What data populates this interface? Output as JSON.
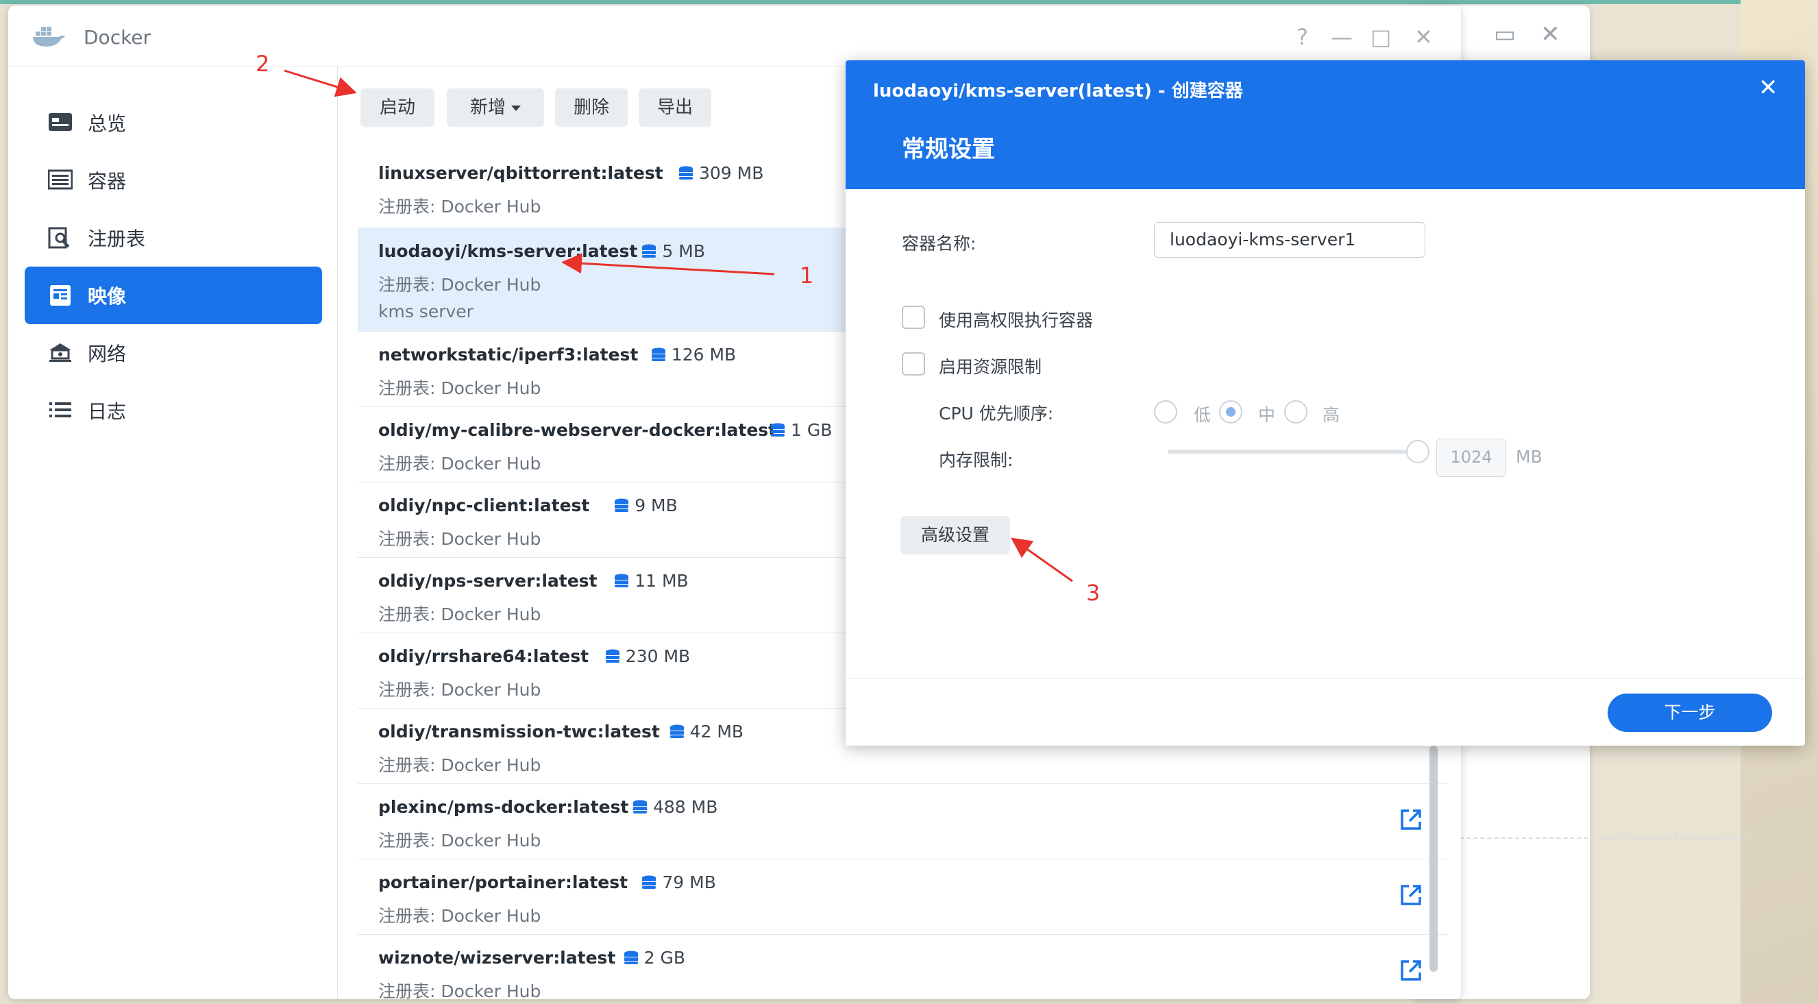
{
  "app": {
    "title": "Docker",
    "window_controls": [
      "?",
      "—",
      "□",
      "✕"
    ]
  },
  "sidebar": {
    "items": [
      {
        "label": "总览",
        "icon": "overview-icon",
        "active": false
      },
      {
        "label": "容器",
        "icon": "container-icon",
        "active": false
      },
      {
        "label": "注册表",
        "icon": "registry-icon",
        "active": false
      },
      {
        "label": "映像",
        "icon": "image-icon",
        "active": true
      },
      {
        "label": "网络",
        "icon": "network-icon",
        "active": false
      },
      {
        "label": "日志",
        "icon": "log-icon",
        "active": false
      }
    ]
  },
  "toolbar": {
    "launch": "启动",
    "add": "新增",
    "delete": "删除",
    "export": "导出"
  },
  "images": [
    {
      "name": "linuxserver/qbittorrent:latest",
      "size": "309 MB",
      "registry": "注册表: Docker Hub",
      "desc": ""
    },
    {
      "name": "luodaoyi/kms-server:latest",
      "size": "5 MB",
      "registry": "注册表: Docker Hub",
      "desc": "kms server"
    },
    {
      "name": "networkstatic/iperf3:latest",
      "size": "126 MB",
      "registry": "注册表: Docker Hub",
      "desc": ""
    },
    {
      "name": "oldiy/my-calibre-webserver-docker:latest",
      "size": "1 GB",
      "registry": "注册表: Docker Hub",
      "desc": ""
    },
    {
      "name": "oldiy/npc-client:latest",
      "size": "9 MB",
      "registry": "注册表: Docker Hub",
      "desc": ""
    },
    {
      "name": "oldiy/nps-server:latest",
      "size": "11 MB",
      "registry": "注册表: Docker Hub",
      "desc": ""
    },
    {
      "name": "oldiy/rrshare64:latest",
      "size": "230 MB",
      "registry": "注册表: Docker Hub",
      "desc": ""
    },
    {
      "name": "oldiy/transmission-twc:latest",
      "size": "42 MB",
      "registry": "注册表: Docker Hub",
      "desc": ""
    },
    {
      "name": "plexinc/pms-docker:latest",
      "size": "488 MB",
      "registry": "注册表: Docker Hub",
      "desc": ""
    },
    {
      "name": "portainer/portainer:latest",
      "size": "79 MB",
      "registry": "注册表: Docker Hub",
      "desc": ""
    },
    {
      "name": "wiznote/wizserver:latest",
      "size": "2 GB",
      "registry": "注册表: Docker Hub",
      "desc": ""
    }
  ],
  "dialog": {
    "title": "luodaoyi/kms-server(latest) - 创建容器",
    "section": "常规设置",
    "container_name_label": "容器名称:",
    "container_name_value": "luodaoyi-kms-server1",
    "privileged_label": "使用高权限执行容器",
    "resource_limit_label": "启用资源限制",
    "cpu_label": "CPU 优先顺序:",
    "cpu_options": [
      "低",
      "中",
      "高"
    ],
    "cpu_selected": "中",
    "memory_label": "内存限制:",
    "memory_value": "1024",
    "memory_unit": "MB",
    "advanced_button": "高级设置",
    "next_button": "下一步"
  },
  "annotations": [
    "1",
    "2",
    "3"
  ],
  "colors": {
    "accent": "#1a73e8",
    "annotation": "#e8322b",
    "selected_row": "#e2eefc"
  }
}
